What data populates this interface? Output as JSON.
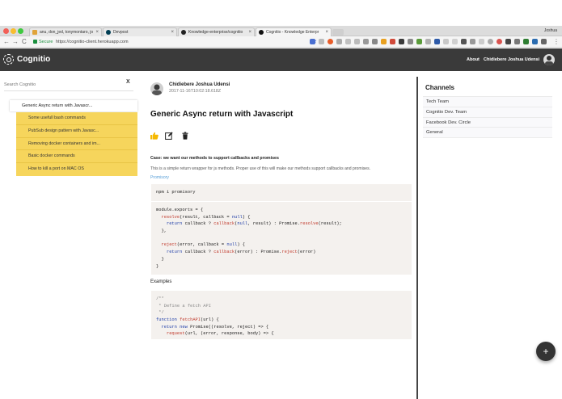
{
  "browser": {
    "tabs": [
      {
        "title": "anu, don_jed, tonymontaro, jo",
        "close": "×",
        "favicon_color": "#e0a43a"
      },
      {
        "title": "Devpost",
        "close": "×",
        "favicon_color": "#003e54"
      },
      {
        "title": "Knowledge-enterprise/cognitio",
        "close": "×",
        "favicon_color": "#222222"
      },
      {
        "title": "Cognitio - Knowledge Enterpr",
        "close": "×",
        "favicon_color": "#111111"
      }
    ],
    "user_label": "Joshua",
    "nav": {
      "back": "←",
      "forward": "→",
      "reload": "C"
    },
    "secure_label": "Secure",
    "url": "https://cognitio-client.herokuapp.com",
    "star_icon": "star-icon"
  },
  "app": {
    "brand": "Cognitio",
    "nav_about": "About",
    "nav_user": "Chidiebere Joshua Udensi"
  },
  "sidebar": {
    "search_placeholder": "Search Cognitio",
    "close": "X",
    "active_item": "Generic Async return with Javascr...",
    "children": [
      "Some usefull bash commands",
      "PubSub design pattern with Javasc...",
      "Removing docker containers and im...",
      "Basic docker commands",
      "How to kill a port on MAC OS"
    ],
    "highlight_color": "#f6d55c"
  },
  "post": {
    "author": "Chidiebere Joshua Udensi",
    "date": "2017-11-16T10:02:18.618Z",
    "title": "Generic Async return with Javascript",
    "actions": [
      "thumbs-up-icon",
      "edit-icon",
      "trash-icon"
    ],
    "subheading": "Case: we want our methods to support callbacks and promises",
    "paragraph": "This is a simple return wrapper for js methods. Proper use of this will make our methods support callbacks and promises.",
    "link": "Promisory",
    "install_cmd": "npm i promisory",
    "code1": [
      "module.exports = {",
      "  resolve(result, callback = null) {",
      "    return callback ? callback(null, result) : Promise.resolve(result);",
      "  },",
      "",
      "  reject(error, callback = null) {",
      "    return callback ? callback(error) : Promise.reject(error)",
      "  }",
      "}"
    ],
    "examples_label": "Examples",
    "code2": [
      "/**",
      " * Define a fetch API",
      " */",
      "function fetchAPI(url) {",
      "  return new Promise((resolve, reject) => {",
      "    request(url, (error, response, body) => {"
    ]
  },
  "channels": {
    "title": "Channels",
    "items": [
      "Tech Team",
      "Cognitio Dev. Team",
      "Facebook Dev. Circle",
      "General"
    ]
  },
  "fab": "+"
}
